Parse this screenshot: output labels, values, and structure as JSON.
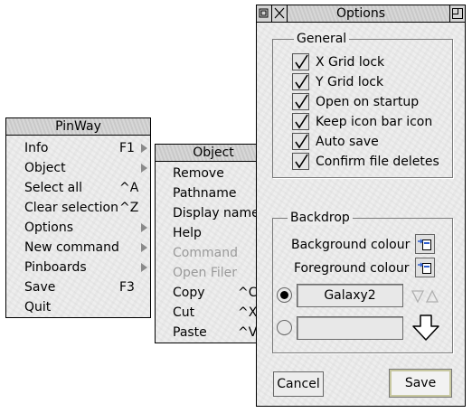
{
  "pinway_menu": {
    "title": "PinWay",
    "items": [
      {
        "label": "Info",
        "shortcut": "F1",
        "submenu": true
      },
      {
        "label": "Object",
        "shortcut": "",
        "submenu": true
      },
      {
        "label": "Select all",
        "shortcut": "^A",
        "submenu": false
      },
      {
        "label": "Clear selection",
        "shortcut": "^Z",
        "submenu": false
      },
      {
        "label": "Options",
        "shortcut": "",
        "submenu": true
      },
      {
        "label": "New command",
        "shortcut": "",
        "submenu": true
      },
      {
        "label": "Pinboards",
        "shortcut": "",
        "submenu": true
      },
      {
        "label": "Save",
        "shortcut": "F3",
        "submenu": false
      },
      {
        "label": "Quit",
        "shortcut": "",
        "submenu": false
      }
    ]
  },
  "object_menu": {
    "title": "Object",
    "items": [
      {
        "label": "Remove",
        "shortcut": "",
        "submenu": false,
        "enabled": true
      },
      {
        "label": "Pathname",
        "shortcut": "",
        "submenu": true,
        "enabled": true
      },
      {
        "label": "Display name",
        "shortcut": "",
        "submenu": true,
        "enabled": true
      },
      {
        "label": "Help",
        "shortcut": "",
        "submenu": false,
        "enabled": true
      },
      {
        "label": "Command",
        "shortcut": "",
        "submenu": true,
        "enabled": false
      },
      {
        "label": "Open Filer",
        "shortcut": "",
        "submenu": false,
        "enabled": false
      },
      {
        "label": "Copy",
        "shortcut": "^C",
        "submenu": false,
        "enabled": true
      },
      {
        "label": "Cut",
        "shortcut": "^X",
        "submenu": false,
        "enabled": true
      },
      {
        "label": "Paste",
        "shortcut": "^V",
        "submenu": false,
        "enabled": true
      }
    ]
  },
  "options_window": {
    "title": "Options",
    "general": {
      "heading": "General",
      "options": [
        {
          "label": "X Grid lock",
          "checked": true
        },
        {
          "label": "Y Grid lock",
          "checked": true
        },
        {
          "label": "Open on startup",
          "checked": true
        },
        {
          "label": "Keep icon bar icon",
          "checked": true
        },
        {
          "label": "Auto save",
          "checked": true
        },
        {
          "label": "Confirm file deletes",
          "checked": true
        }
      ]
    },
    "backdrop": {
      "heading": "Backdrop",
      "background_colour_label": "Background colour",
      "foreground_colour_label": "Foreground colour",
      "backdrop_name": "Galaxy2",
      "backdrop_path": "",
      "selected_radio": "backdrop-name"
    },
    "buttons": {
      "cancel": "Cancel",
      "save": "Save"
    }
  },
  "icons": {
    "window_back": "back-icon",
    "window_close": "close-icon",
    "window_toggle": "toggle-size-icon",
    "colour_picker": "colour-picker-icon",
    "bump": "up-down-arrows-icon",
    "drop": "drop-arrow-icon",
    "submenu": "submenu-arrow-icon"
  }
}
